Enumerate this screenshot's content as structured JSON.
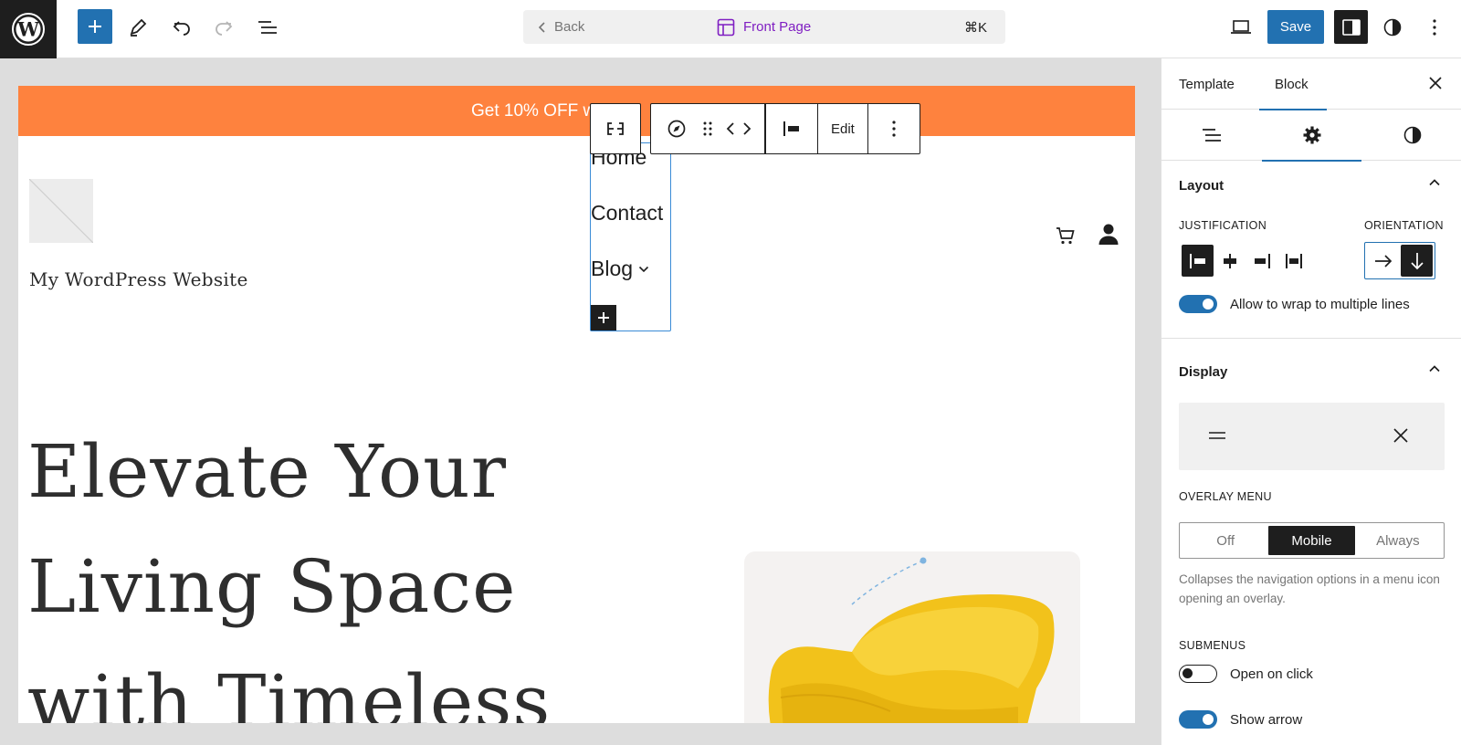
{
  "topbar": {
    "back_label": "Back",
    "page_title": "Front Page",
    "shortcut": "⌘K",
    "save_label": "Save"
  },
  "canvas": {
    "promo_text": "Get 10% OFF with c",
    "site_title": "My WordPress Website",
    "hero_lines": [
      "Elevate Your",
      "Living Space",
      "with Timeless"
    ],
    "nav_items": [
      "Home",
      "Contact",
      "Blog"
    ]
  },
  "block_toolbar": {
    "edit_label": "Edit"
  },
  "sidebar": {
    "tabs": [
      "Template",
      "Block"
    ],
    "layout": {
      "title": "Layout",
      "justification_label": "JUSTIFICATION",
      "orientation_label": "ORIENTATION",
      "wrap_label": "Allow to wrap to multiple lines",
      "wrap_on": true
    },
    "display": {
      "title": "Display",
      "overlay_label": "OVERLAY MENU",
      "overlay_options": [
        "Off",
        "Mobile",
        "Always"
      ],
      "overlay_selected": "Mobile",
      "help_text": "Collapses the navigation options in a menu icon opening an overlay.",
      "submenus_label": "SUBMENUS",
      "open_on_click_label": "Open on click",
      "open_on_click_on": false,
      "show_arrow_label": "Show arrow",
      "show_arrow_on": true
    }
  },
  "colors": {
    "accent": "#2271b1",
    "promo": "#fe823e",
    "title_purple": "#7f1ec2",
    "dark": "#1e1e1e"
  }
}
